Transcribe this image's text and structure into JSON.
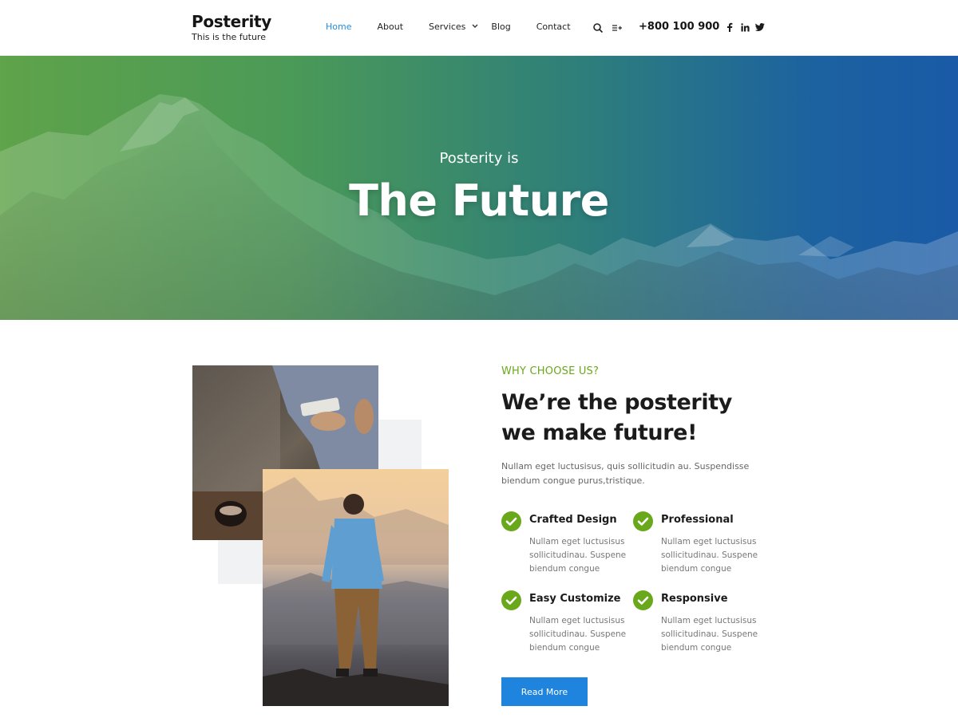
{
  "header": {
    "brand_title": "Posterity",
    "brand_tagline": "This is the future",
    "nav": [
      {
        "label": "Home",
        "active": true
      },
      {
        "label": "About",
        "active": false
      },
      {
        "label": "Services",
        "active": false,
        "has_dropdown": true
      },
      {
        "label": "Blog",
        "active": false
      },
      {
        "label": "Contact",
        "active": false
      }
    ],
    "tools": [
      "search-icon",
      "menu-plus-icon"
    ],
    "phone": "+800 100 900",
    "socials": [
      "facebook-icon",
      "linkedin-icon",
      "twitter-icon"
    ]
  },
  "hero": {
    "subtitle": "Posterity is",
    "title": "The Future"
  },
  "about": {
    "eyebrow": "WHY CHOOSE US?",
    "heading_line1": "We’re the posterity",
    "heading_line2": "we make future!",
    "intro": "Nullam eget luctusisus, quis sollicitudin au. Suspendisse biendum congue purus,tristique.",
    "features": [
      {
        "title": "Crafted Design",
        "desc": "Nullam eget luctusisus sollicitudinau. Suspene biendum congue"
      },
      {
        "title": "Professional",
        "desc": "Nullam eget luctusisus sollicitudinau. Suspene biendum congue"
      },
      {
        "title": "Easy Customize",
        "desc": "Nullam eget luctusisus sollicitudinau. Suspene biendum congue"
      },
      {
        "title": "Responsive",
        "desc": "Nullam eget luctusisus sollicitudinau. Suspene biendum congue"
      }
    ],
    "button_label": "Read More"
  },
  "colors": {
    "accent_blue": "#1f84de",
    "accent_green": "#6aa81b",
    "nav_active": "#1f8de3"
  }
}
